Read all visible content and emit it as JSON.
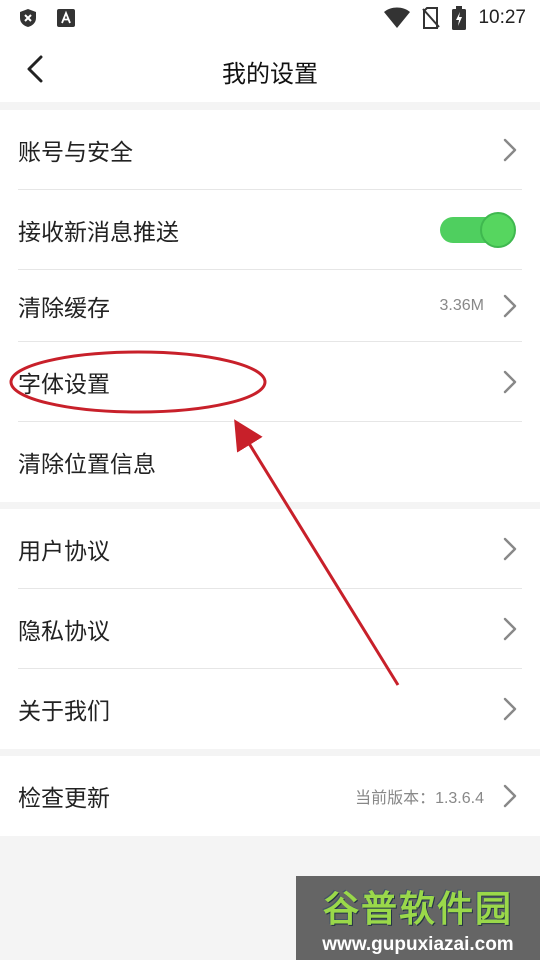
{
  "status_bar": {
    "time": "10:27",
    "icons": [
      "shield-x-icon",
      "font-a-icon",
      "wifi-icon",
      "no-sim-icon",
      "battery-charging-icon"
    ]
  },
  "header": {
    "title": "我的设置",
    "back_icon": "chevron-left-icon"
  },
  "groups": [
    {
      "items": [
        {
          "label": "账号与安全",
          "accessory": "chevron"
        },
        {
          "label": "接收新消息推送",
          "accessory": "toggle",
          "toggle_on": true
        },
        {
          "label": "清除缓存",
          "value": "3.36M",
          "accessory": "chevron"
        },
        {
          "label": "字体设置",
          "accessory": "chevron"
        },
        {
          "label": "清除位置信息",
          "accessory": "none"
        }
      ]
    },
    {
      "items": [
        {
          "label": "用户协议",
          "accessory": "chevron"
        },
        {
          "label": "隐私协议",
          "accessory": "chevron"
        },
        {
          "label": "关于我们",
          "accessory": "chevron"
        }
      ]
    },
    {
      "items": [
        {
          "label": "检查更新",
          "value": "当前版本：1.3.6.4",
          "accessory": "chevron"
        }
      ]
    }
  ],
  "colors": {
    "toggle_on": "#4fcf5f",
    "annotation": "#c8202a",
    "background": "#f4f4f4"
  },
  "watermark": {
    "title": "谷普软件园",
    "url": "www.gupuxiazai.com"
  }
}
